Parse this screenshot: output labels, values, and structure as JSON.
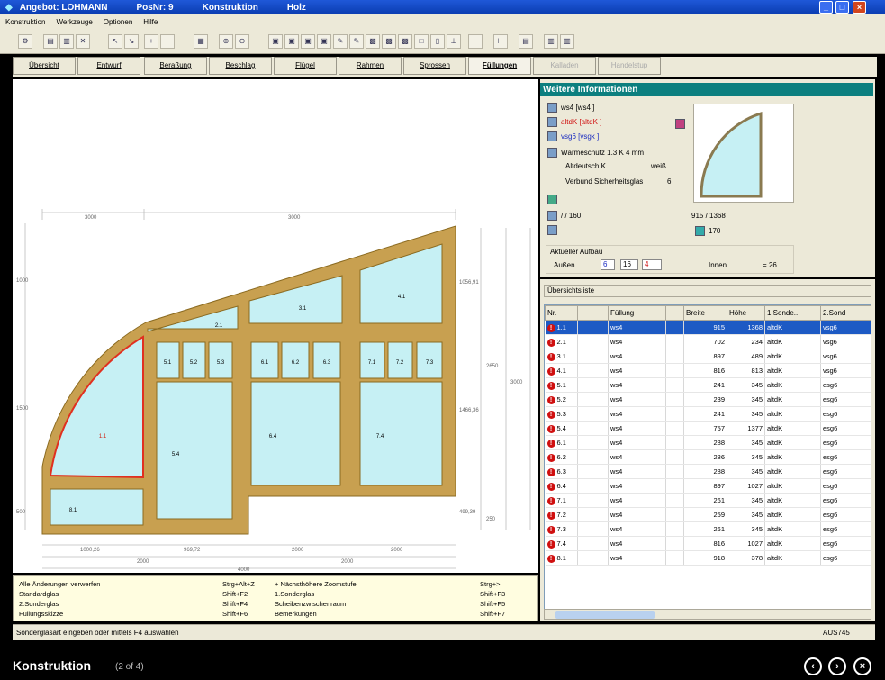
{
  "window": {
    "title_parts": [
      "Angebot: LOHMANN",
      "PosNr: 9",
      "Konstruktion",
      "Holz"
    ],
    "controls": [
      "_",
      "□",
      "×"
    ]
  },
  "menu": [
    "Konstruktion",
    "Werkzeuge",
    "Optionen",
    "Hilfe"
  ],
  "tabs": [
    {
      "label": "Übersicht",
      "state": "normal"
    },
    {
      "label": "Entwurf",
      "state": "normal"
    },
    {
      "label": "Beraßung",
      "state": "normal"
    },
    {
      "label": "Beschlag",
      "state": "normal"
    },
    {
      "label": "Flügel",
      "state": "normal"
    },
    {
      "label": "Rahmen",
      "state": "normal"
    },
    {
      "label": "Sprossen",
      "state": "normal"
    },
    {
      "label": "Füllungen",
      "state": "active"
    },
    {
      "label": "Kalladen",
      "state": "disabled"
    },
    {
      "label": "Handelstup",
      "state": "disabled"
    }
  ],
  "drawing": {
    "dims_top": [
      "3000",
      "3000"
    ],
    "dims_left": [
      "1000",
      "1500",
      "500"
    ],
    "dims_right_inner": [
      "1056,91",
      "1466,36",
      "499,39"
    ],
    "dims_right_mid": [
      "2650",
      "250"
    ],
    "dims_right_outer": "3000",
    "dims_bottom_1": [
      "1000,26",
      "969,72",
      "2000",
      "2000"
    ],
    "dims_bottom_2": [
      "2000",
      "2000"
    ],
    "dims_bottom_3": "4000",
    "panes": [
      "1.1",
      "2.1",
      "3.1",
      "4.1",
      "5.1",
      "5.2",
      "5.3",
      "5.4",
      "6.1",
      "6.2",
      "6.3",
      "6.4",
      "7.1",
      "7.2",
      "7.3",
      "7.4",
      "8.1"
    ]
  },
  "info": {
    "header": "Weitere Informationen",
    "glass1": "ws4 [ws4 ]",
    "glass2": "altdK [altdK ]",
    "glass3": "vsg6 [vsgk ]",
    "warmth": "Wärmeschutz 1.3 K 4 mm",
    "alt_label": "Altdeutsch K",
    "alt_value": "weiß",
    "verbund_label": "Verbund Sicherheitsglas",
    "verbund_value": "6",
    "ratio_left": "/ / 160",
    "ratio_right": "915 / 1368",
    "count_value": "170",
    "aufbau_label": "Aktueller Aufbau",
    "aussen_label": "Außen",
    "aufbau_v1": "6",
    "aufbau_v2": "16",
    "aufbau_v3": "4",
    "innen_label": "Innen",
    "aufbau_total": "= 26"
  },
  "list": {
    "label": "Übersichtsliste",
    "columns": [
      "Nr.",
      "",
      "",
      "Füllung",
      "",
      "Breite",
      "Höhe",
      "1.Sonde...",
      "2.Sond"
    ],
    "rows": [
      {
        "nr": "1.1",
        "fill": "ws4",
        "b": "915",
        "h": "1368",
        "s1": "altdK",
        "s2": "vsg6",
        "selected": true
      },
      {
        "nr": "2.1",
        "fill": "ws4",
        "b": "702",
        "h": "234",
        "s1": "altdK",
        "s2": "vsg6"
      },
      {
        "nr": "3.1",
        "fill": "ws4",
        "b": "897",
        "h": "489",
        "s1": "altdK",
        "s2": "vsg6"
      },
      {
        "nr": "4.1",
        "fill": "ws4",
        "b": "816",
        "h": "813",
        "s1": "altdK",
        "s2": "vsg6"
      },
      {
        "nr": "5.1",
        "fill": "ws4",
        "b": "241",
        "h": "345",
        "s1": "altdK",
        "s2": "esg6"
      },
      {
        "nr": "5.2",
        "fill": "ws4",
        "b": "239",
        "h": "345",
        "s1": "altdK",
        "s2": "esg6"
      },
      {
        "nr": "5.3",
        "fill": "ws4",
        "b": "241",
        "h": "345",
        "s1": "altdK",
        "s2": "esg6"
      },
      {
        "nr": "5.4",
        "fill": "ws4",
        "b": "757",
        "h": "1377",
        "s1": "altdK",
        "s2": "esg6"
      },
      {
        "nr": "6.1",
        "fill": "ws4",
        "b": "288",
        "h": "345",
        "s1": "altdK",
        "s2": "esg6"
      },
      {
        "nr": "6.2",
        "fill": "ws4",
        "b": "286",
        "h": "345",
        "s1": "altdK",
        "s2": "esg6"
      },
      {
        "nr": "6.3",
        "fill": "ws4",
        "b": "288",
        "h": "345",
        "s1": "altdK",
        "s2": "esg6"
      },
      {
        "nr": "6.4",
        "fill": "ws4",
        "b": "897",
        "h": "1027",
        "s1": "altdK",
        "s2": "esg6"
      },
      {
        "nr": "7.1",
        "fill": "ws4",
        "b": "261",
        "h": "345",
        "s1": "altdK",
        "s2": "esg6"
      },
      {
        "nr": "7.2",
        "fill": "ws4",
        "b": "259",
        "h": "345",
        "s1": "altdK",
        "s2": "esg6"
      },
      {
        "nr": "7.3",
        "fill": "ws4",
        "b": "261",
        "h": "345",
        "s1": "altdK",
        "s2": "esg6"
      },
      {
        "nr": "7.4",
        "fill": "ws4",
        "b": "816",
        "h": "1027",
        "s1": "altdK",
        "s2": "esg6"
      },
      {
        "nr": "8.1",
        "fill": "ws4",
        "b": "918",
        "h": "378",
        "s1": "altdK",
        "s2": "esg6"
      }
    ]
  },
  "help": [
    {
      "a": "Alle Änderungen verwerfen",
      "ak": "Strg+Alt+Z",
      "b": "+ Nächsthöhere Zoomstufe",
      "bk": "Strg+>"
    },
    {
      "a": "Standardglas",
      "ak": "Shift+F2",
      "b": "1.Sonderglas",
      "bk": "Shift+F3"
    },
    {
      "a": "2.Sonderglas",
      "ak": "Shift+F4",
      "b": "Scheibenzwischenraum",
      "bk": "Shift+F5"
    },
    {
      "a": "Füllungsskizze",
      "ak": "Shift+F6",
      "b": "Bemerkungen",
      "bk": "Shift+F7"
    }
  ],
  "status": {
    "text": "Sonderglasart eingeben oder mittels F4 auswählen",
    "right": "AUS745"
  },
  "caption": {
    "title": "Konstruktion",
    "counter": "(2 of 4)"
  },
  "colors": {
    "accent": "#0c7f7f",
    "frame": "#c8a050",
    "glass": "#c6f0f4",
    "selection": "#1d5ac4"
  }
}
